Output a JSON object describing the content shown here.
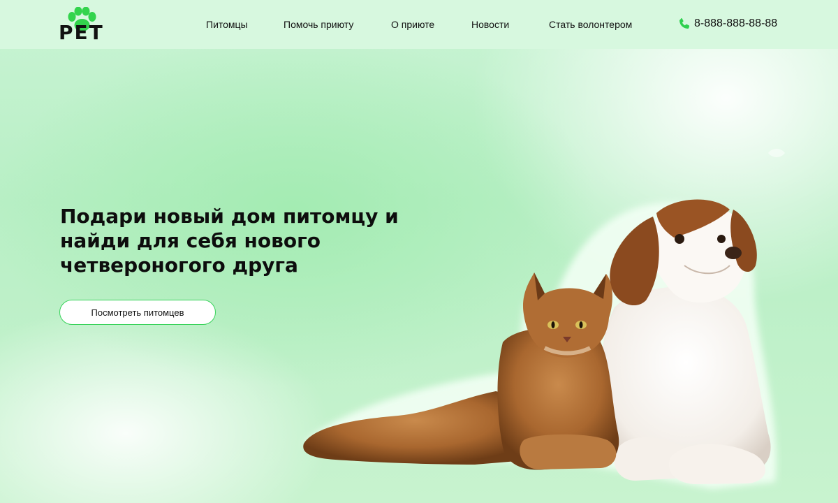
{
  "header": {
    "logo": {
      "text": "PET",
      "paw_color": "#33d44d"
    },
    "nav": [
      {
        "label": "Питомцы"
      },
      {
        "label": "Помочь приюту"
      },
      {
        "label": "О приюте"
      },
      {
        "label": "Новости"
      },
      {
        "label": "Стать волонтером"
      }
    ],
    "phone": {
      "icon": "phone-icon",
      "number": "8-888-888-88-88",
      "icon_color": "#2fd14f"
    }
  },
  "hero": {
    "title": "Подари новый дом питомцу и найди для себя нового четвероногого друга",
    "cta_label": "Посмотреть питомцев",
    "image": "cat-and-dog-illustration"
  },
  "colors": {
    "accent": "#39d35b",
    "header_bg": "#d7f8df",
    "text": "#0d0d0d"
  }
}
